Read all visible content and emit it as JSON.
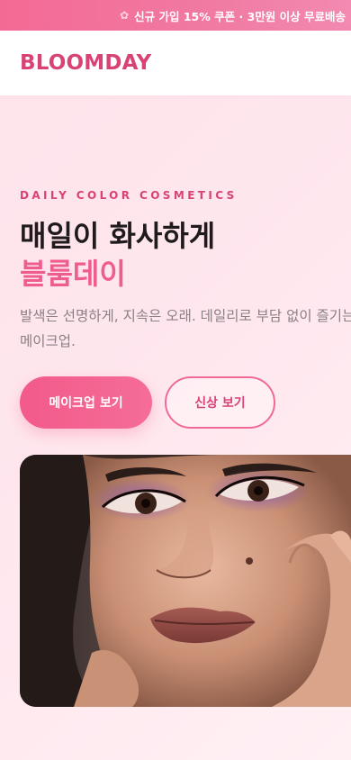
{
  "promo": {
    "icon": "flower-icon",
    "text": "신규 가입 15% 쿠폰 · 3만원 이상 무료배송"
  },
  "header": {
    "logo": "BLOOMDAY"
  },
  "hero": {
    "eyebrow": "DAILY COLOR COSMETICS",
    "headline_line1": "매일이 화사하게",
    "headline_line2": "블룸데이",
    "description": "발색은 선명하게, 지속은 오래. 데일리로 부담 없이 즐기는 메이크업.",
    "primary_button": "메이크업 보기",
    "secondary_button": "신상 보기"
  },
  "colors": {
    "brand": "#d94277",
    "accent": "#ef5d8e",
    "promo_bg": "#f46a95"
  }
}
